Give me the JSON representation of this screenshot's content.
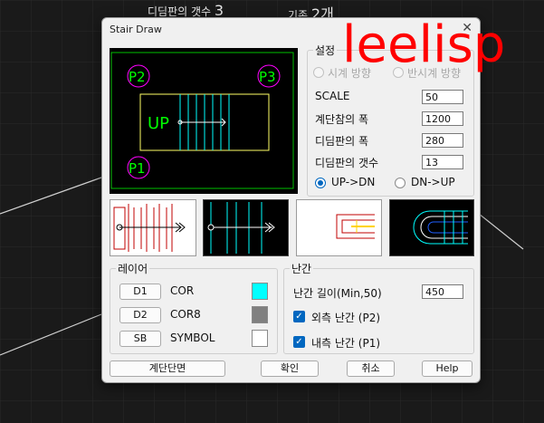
{
  "top_labels": {
    "count_label": "디딤판의 갯수",
    "count_value": "3",
    "base_label": "기존",
    "base_value": "2개"
  },
  "dialog": {
    "title": "Stair Draw"
  },
  "preview": {
    "p1": "P1",
    "p2": "P2",
    "p3": "P3",
    "up": "UP"
  },
  "settings": {
    "legend": "설정",
    "radio_cw": "시계 방향",
    "radio_ccw": "반시계 방향",
    "scale_label": "SCALE",
    "scale_value": "50",
    "landing_width_label": "계단참의 폭",
    "landing_width_value": "1200",
    "tread_width_label": "디딤판의 폭",
    "tread_width_value": "280",
    "tread_count_label": "디딤판의 갯수",
    "tread_count_value": "13",
    "dir_updn": "UP->DN",
    "dir_dnup": "DN->UP",
    "dir_selected": "UP->DN"
  },
  "layer": {
    "legend": "레이어",
    "rows": [
      {
        "button": "D1",
        "name": "COR",
        "color": "#00ffff"
      },
      {
        "button": "D2",
        "name": "COR8",
        "color": "#808080"
      },
      {
        "button": "SB",
        "name": "SYMBOL",
        "color": "#ffffff"
      }
    ]
  },
  "railing": {
    "legend": "난간",
    "length_label": "난간 길이(Min,50)",
    "length_value": "450",
    "outer_label": "외측 난간 (P2)",
    "outer_checked": true,
    "inner_label": "내측 난간 (P1)",
    "inner_checked": true
  },
  "buttons": {
    "section": "계단단면",
    "ok": "확인",
    "cancel": "취소",
    "help": "Help"
  },
  "watermark": "leelisp"
}
